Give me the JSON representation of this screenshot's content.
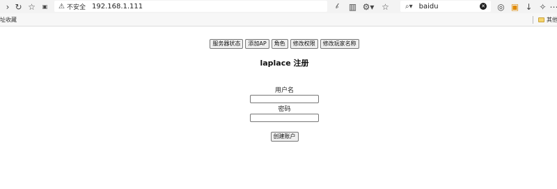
{
  "browser": {
    "security_label": "不安全",
    "url": "192.168.1.111",
    "search_query": "baidu",
    "bookmarks_left": "址收藏",
    "bookmark_right": "其他"
  },
  "page": {
    "nav_buttons": [
      "服务器状态",
      "添加AP",
      "角色",
      "修改权限",
      "修改玩家名称"
    ],
    "title": "laplace 注册",
    "username_label": "用户名",
    "username_value": "",
    "password_label": "密码",
    "password_value": "",
    "create_button": "创建账户"
  }
}
